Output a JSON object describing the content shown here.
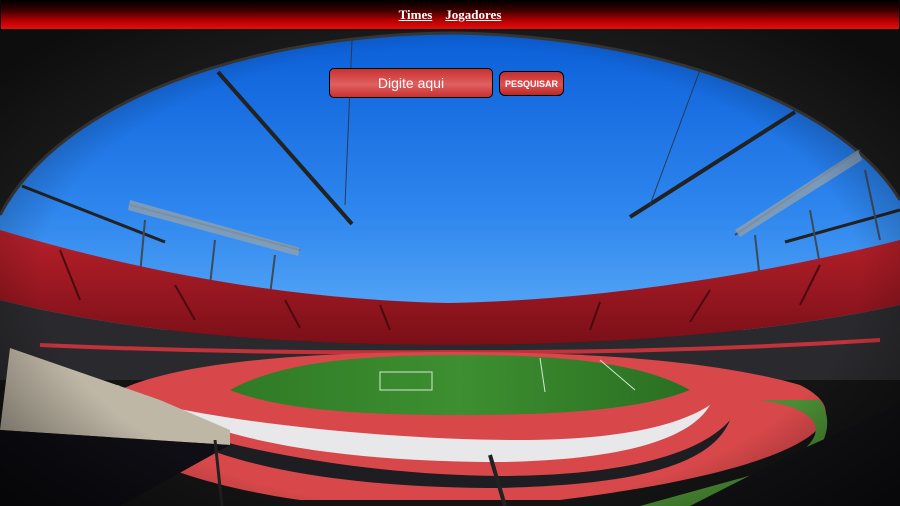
{
  "nav": {
    "links": [
      {
        "label": "Times"
      },
      {
        "label": "Jogadores"
      }
    ]
  },
  "search": {
    "placeholder": "Digite aqui",
    "button_label": "PESQUISAR"
  },
  "colors": {
    "accent_red": "#d83a3a",
    "sky_blue": "#2a7ae8",
    "pitch_green": "#2f7d2a",
    "track_red": "#d84a4a"
  }
}
